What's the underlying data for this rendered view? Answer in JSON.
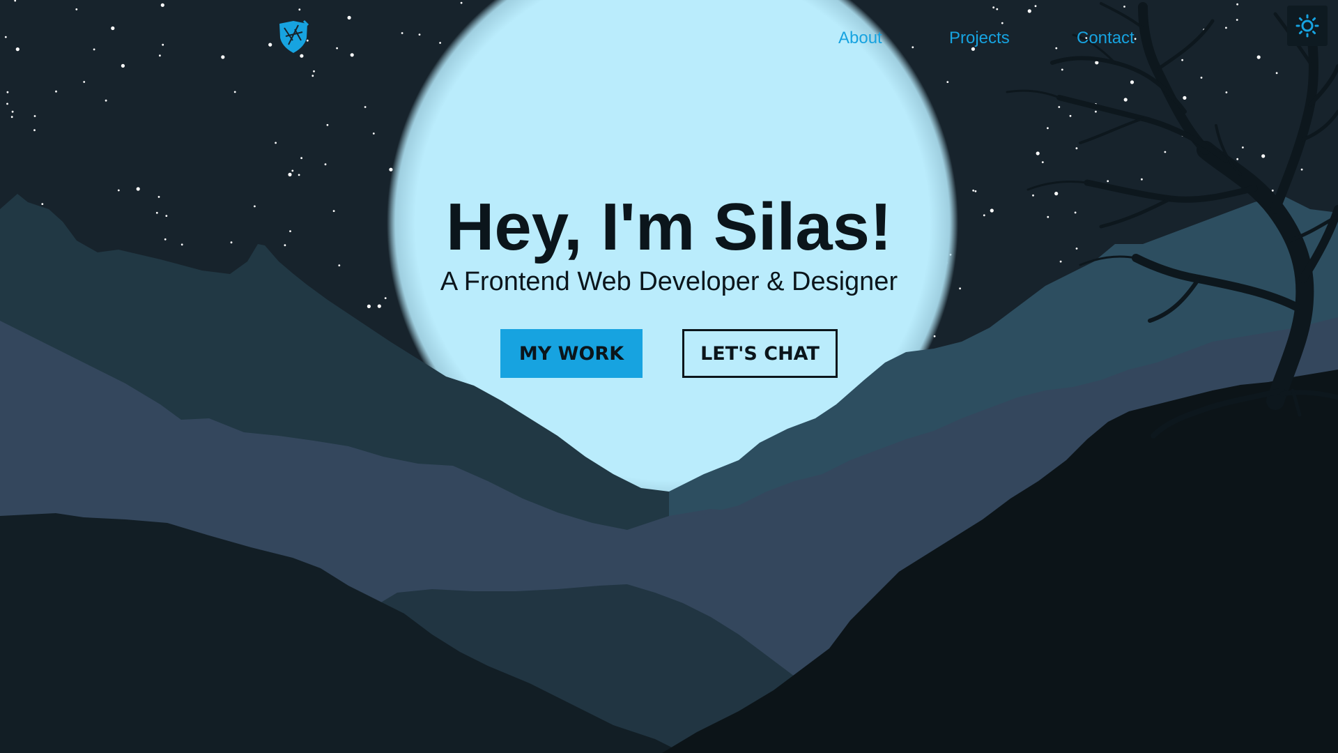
{
  "colors": {
    "accent": "#17a3e0",
    "sky": "#17232c",
    "moon": "#baecfc",
    "text_dark": "#0b151b",
    "star": "#ffffff"
  },
  "header": {
    "logo_icon": "shield-logo-icon",
    "nav": [
      {
        "label": "About"
      },
      {
        "label": "Projects"
      },
      {
        "label": "Contact"
      }
    ],
    "theme_toggle_icon": "sun-icon"
  },
  "hero": {
    "title": "Hey, I'm Silas!",
    "subtitle": "A Frontend Web Developer & Designer",
    "primary_button": "MY WORK",
    "secondary_button": "LET'S CHAT"
  },
  "scene": {
    "elements": [
      "starry-night-sky",
      "full-moon",
      "layered-mountains",
      "bare-tree-silhouette"
    ]
  }
}
